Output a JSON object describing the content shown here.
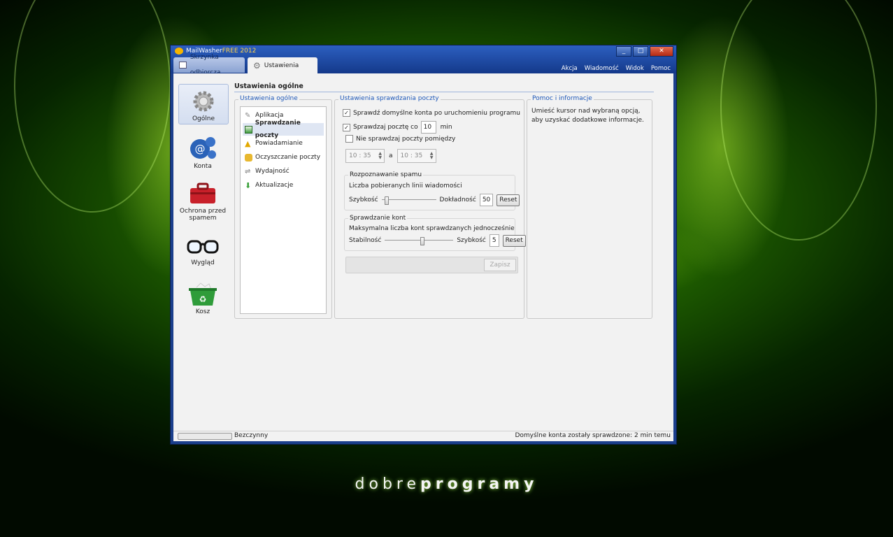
{
  "app": {
    "title_prefix": "MailWasher",
    "title_suffix": "FREE 2012",
    "tabs": [
      {
        "label": "Skrzynka odbiorcza"
      },
      {
        "label": "Ustawienia"
      }
    ],
    "window_buttons": [
      "_",
      "□",
      "✕"
    ],
    "menu": [
      "Akcja",
      "Wiadomość",
      "Widok",
      "Pomoc"
    ]
  },
  "sidebar": {
    "items": [
      {
        "label": "Ogólne",
        "icon": "gear-icon"
      },
      {
        "label": "Konta",
        "icon": "at-sign-icon"
      },
      {
        "label": "Ochrona przed spamem",
        "icon": "toolbox-icon"
      },
      {
        "label": "Wygląd",
        "icon": "glasses-icon"
      },
      {
        "label": "Kosz",
        "icon": "recycle-bin-icon"
      }
    ]
  },
  "page": {
    "title": "Ustawienia ogólne"
  },
  "general_group": {
    "label": "Ustawienia ogólne",
    "items": [
      {
        "label": "Aplikacja",
        "icon": "wrench-icon"
      },
      {
        "label": "Sprawdzanie poczty",
        "icon": "inbox-icon"
      },
      {
        "label": "Powiadamianie",
        "icon": "warning-icon"
      },
      {
        "label": "Oczyszczanie poczty",
        "icon": "cleaner-icon"
      },
      {
        "label": "Wydajność",
        "icon": "speed-icon"
      },
      {
        "label": "Aktualizacje",
        "icon": "download-arrow-icon"
      }
    ]
  },
  "mail_check": {
    "label": "Ustawienia sprawdzania poczty",
    "check_on_start": "Sprawdź domyślne konta po uruchomieniu programu",
    "check_every_prefix": "Sprawdzaj pocztę co",
    "check_every_value": "10",
    "check_every_unit": "min",
    "no_check_between": "Nie sprawdzaj poczty pomiędzy",
    "time_from": "10 : 35",
    "time_sep": "a",
    "time_to": "10 : 35",
    "spam": {
      "label": "Rozpoznawanie spamu",
      "desc": "Liczba pobieranych linii wiadomości",
      "left": "Szybkość",
      "right": "Dokładność",
      "value": "50",
      "reset": "Reset",
      "level": 0.05
    },
    "accounts": {
      "label": "Sprawdzanie kont",
      "desc": "Maksymalna liczba kont sprawdzanych jednocześnie",
      "left": "Stabilność",
      "right": "Szybkość",
      "value": "5",
      "reset": "Reset",
      "level": 0.55
    },
    "save": "Zapisz"
  },
  "help": {
    "label": "Pomoc i informacje",
    "text": "Umieść kursor nad wybraną opcją, aby uzyskać dodatkowe informacje."
  },
  "status": {
    "left": "Bezczynny",
    "right": "Domyślne konta zostały sprawdzone: 2 min temu"
  },
  "brand": {
    "part1": "dobre",
    "part2": "programy"
  }
}
